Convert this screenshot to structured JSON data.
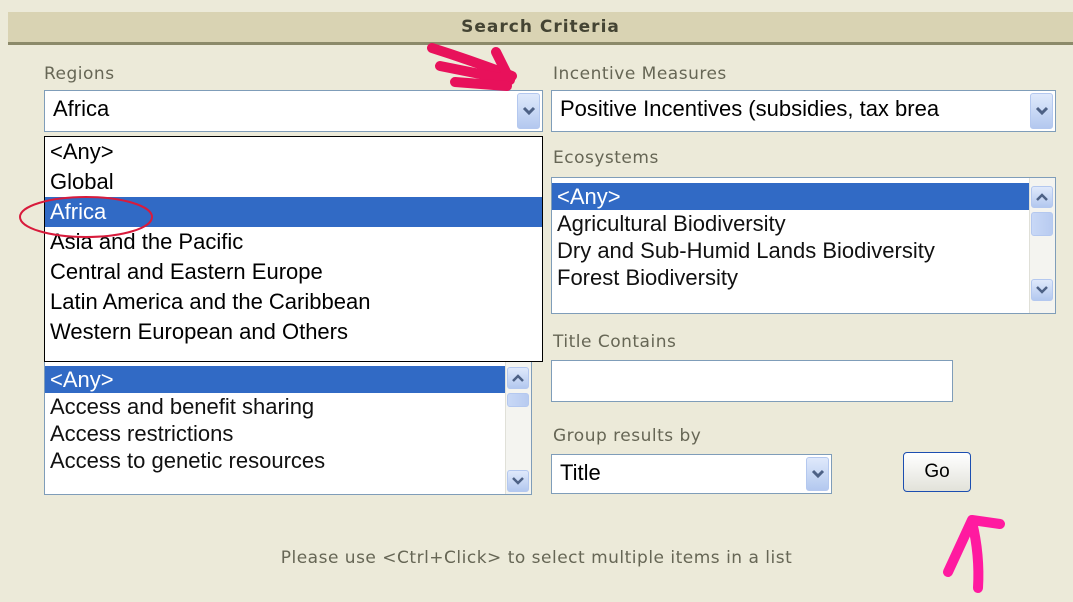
{
  "header": {
    "title": "Search Criteria"
  },
  "regions": {
    "label": "Regions",
    "selected": "Africa",
    "dropdown_options": [
      "<Any>",
      "Global",
      "Africa",
      "Asia and the Pacific",
      "Central and Eastern Europe",
      "Latin America and the Caribbean",
      "Western European and Others"
    ],
    "highlighted": "Africa"
  },
  "incentive_measures": {
    "label": "Incentive Measures",
    "selected": "Positive Incentives (subsidies, tax brea"
  },
  "ecosystems": {
    "label": "Ecosystems",
    "options": [
      "<Any>",
      "Agricultural Biodiversity",
      "Dry and Sub-Humid Lands Biodiversity",
      "Forest Biodiversity"
    ],
    "selected": "<Any>"
  },
  "issues": {
    "options": [
      "<Any>",
      "Access and benefit sharing",
      "Access restrictions",
      "Access to genetic resources"
    ],
    "selected": "<Any>"
  },
  "title_contains": {
    "label": "Title Contains",
    "value": ""
  },
  "group_by": {
    "label": "Group results by",
    "selected": "Title"
  },
  "go_button": {
    "label": "Go"
  },
  "hint": "Please use <Ctrl+Click> to select multiple items in a list",
  "colors": {
    "accent": "#316ac5",
    "background": "#ecead9",
    "header": "#d9d3b3",
    "annotation": "#e8115b"
  }
}
